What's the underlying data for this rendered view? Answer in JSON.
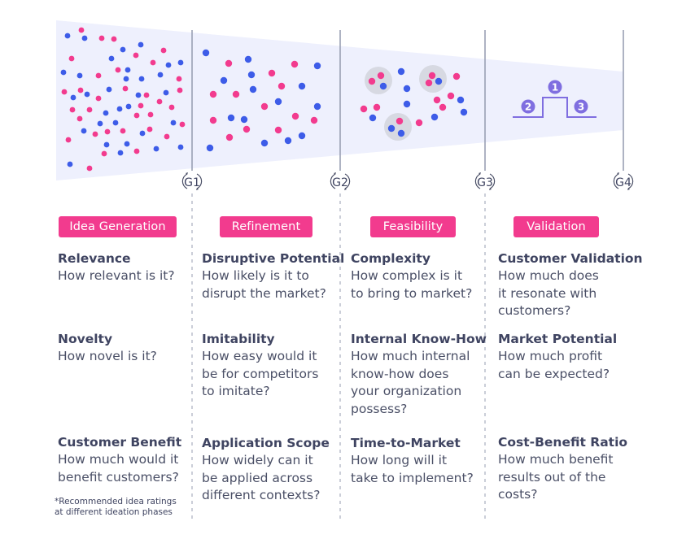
{
  "colors": {
    "funnel": "#eef0fd",
    "pink": "#f23b8e",
    "blue": "#3d5ce8",
    "purple": "#7f6ee0",
    "gate_line": "#9aa0b4",
    "cluster": "#d7d9e2",
    "text_dark": "#3f4461"
  },
  "gates": [
    {
      "label": "G1"
    },
    {
      "label": "G2"
    },
    {
      "label": "G3"
    },
    {
      "label": "G4"
    }
  ],
  "validation_steps": [
    "1",
    "2",
    "3"
  ],
  "phases": [
    {
      "label": "Idea Generation",
      "criteria": [
        {
          "title": "Relevance",
          "question": "How relevant is it?"
        },
        {
          "title": "Novelty",
          "question": "How novel is it?"
        },
        {
          "title": "Customer Benefit",
          "question": "How much would it\nbenefit customers?"
        }
      ]
    },
    {
      "label": "Refinement",
      "criteria": [
        {
          "title": "Disruptive Potential",
          "question": "How likely is it to\ndisrupt the market?"
        },
        {
          "title": "Imitability",
          "question": "How easy would it\nbe for competitors\nto imitate?"
        },
        {
          "title": "Application Scope",
          "question": "How widely can it\nbe applied across\ndifferent contexts?"
        }
      ]
    },
    {
      "label": "Feasibility",
      "criteria": [
        {
          "title": "Complexity",
          "question": "How complex is it\nto bring to market?"
        },
        {
          "title": "Internal Know-How",
          "question": "How much internal\nknow-how does\nyour organization\npossess?"
        },
        {
          "title": "Time-to-Market",
          "question": "How long will it\ntake to implement?"
        }
      ]
    },
    {
      "label": "Validation",
      "criteria": [
        {
          "title": "Customer Validation",
          "question": "How much does\nit resonate with\ncustomers?"
        },
        {
          "title": "Market Potential",
          "question": "How much profit\ncan be expected?"
        },
        {
          "title": "Cost-Benefit Ratio",
          "question": "How much benefit\nresults out of the\ncosts?"
        }
      ]
    }
  ],
  "footnote": "*Recommended idea ratings\n at different ideation phases"
}
